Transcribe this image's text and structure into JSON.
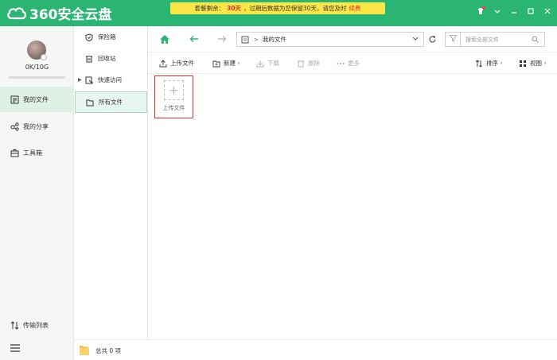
{
  "app": {
    "name": "360安全云盘"
  },
  "notice": {
    "prefix": "套餐剩余：",
    "days": "30天",
    "suffix": "，过期后数据为您保留30天，请您及时",
    "renew": "续费"
  },
  "user": {
    "quota": "0K/10G",
    "used_fraction": 0
  },
  "sidebar": {
    "items": [
      {
        "label": "我的文件",
        "icon": "file-list-icon",
        "active": true
      },
      {
        "label": "我的分享",
        "icon": "share-icon",
        "active": false
      },
      {
        "label": "工具箱",
        "icon": "toolbox-icon",
        "active": false
      }
    ],
    "transfer_label": "传输列表"
  },
  "subnav": {
    "items": [
      {
        "label": "保险箱",
        "icon": "shield-icon",
        "active": false
      },
      {
        "label": "回收站",
        "icon": "trash-icon",
        "active": false
      },
      {
        "label": "快速访问",
        "icon": "quick-access-icon",
        "active": false
      },
      {
        "label": "所有文件",
        "icon": "folder-icon",
        "active": true
      }
    ]
  },
  "navbar": {
    "path_label": "我的文件",
    "search_placeholder": "搜索全部文件"
  },
  "toolbar": {
    "upload": "上传文件",
    "new": "新建",
    "download": "下载",
    "delete": "删除",
    "more": "更多",
    "sort": "排序",
    "view": "视图"
  },
  "content": {
    "upload_tile_label": "上传文件"
  },
  "status": {
    "count": "总共 0 项"
  },
  "colors": {
    "brand": "#2bb573",
    "notice_bg": "#fde647",
    "highlight": "#e0322b"
  }
}
